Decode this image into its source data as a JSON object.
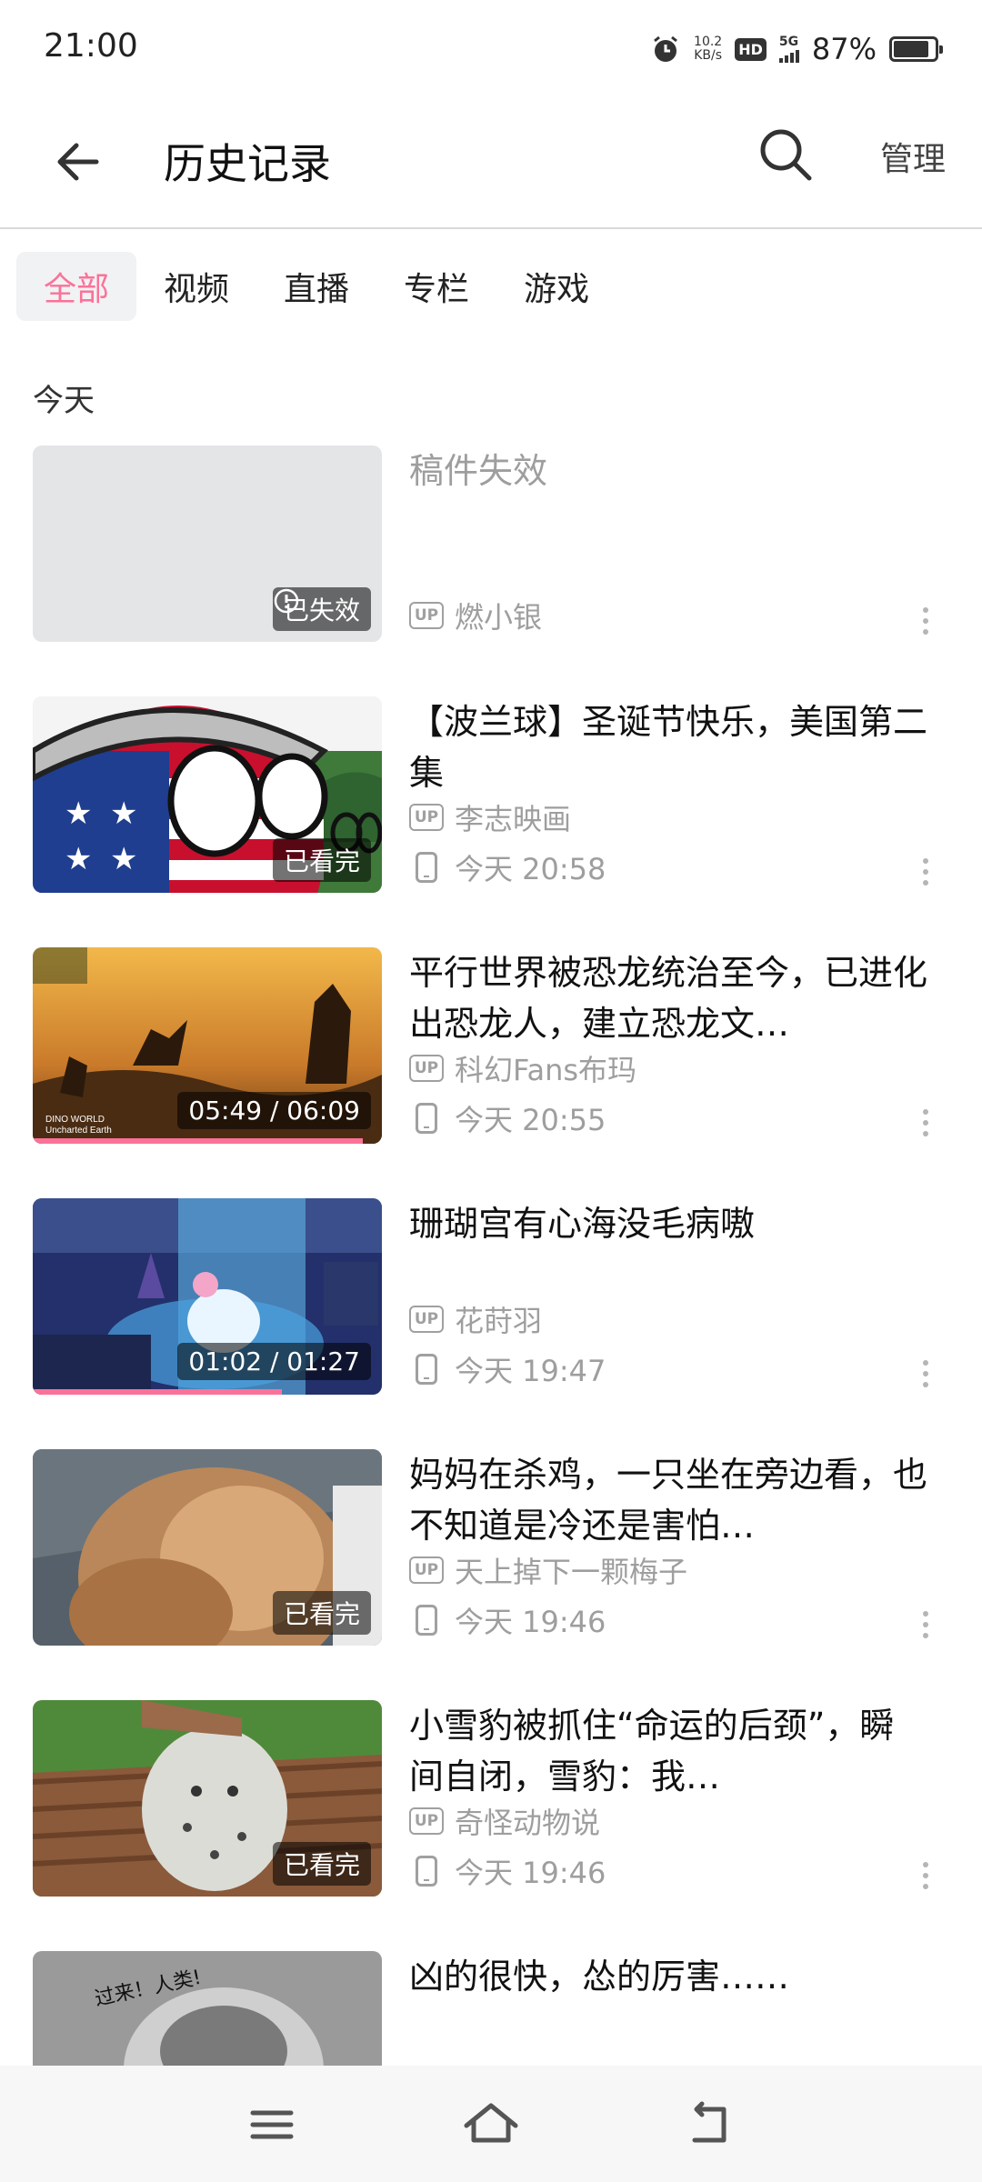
{
  "status_bar": {
    "time": "21:00",
    "net_speed_value": "10.2",
    "net_speed_unit": "KB/s",
    "hd_label": "HD",
    "network": "5G",
    "battery_percent": "87%",
    "battery_level": 0.87
  },
  "header": {
    "title": "历史记录",
    "manage_label": "管理"
  },
  "tabs": [
    {
      "label": "全部",
      "active": true
    },
    {
      "label": "视频",
      "active": false
    },
    {
      "label": "直播",
      "active": false
    },
    {
      "label": "专栏",
      "active": false
    },
    {
      "label": "游戏",
      "active": false
    }
  ],
  "section_title": "今天",
  "items": [
    {
      "title": "稿件失效",
      "up": "燃小银",
      "time": "",
      "badge": "已失效",
      "progress": 0,
      "invalid": true
    },
    {
      "title": "【波兰球】圣诞节快乐，美国第二集",
      "up": "李志映画",
      "time": "今天 20:58",
      "badge": "已看完",
      "progress": 0
    },
    {
      "title": "平行世界被恐龙统治至今，已进化出恐龙人，建立恐龙文…",
      "up": "科幻Fans布玛",
      "time": "今天 20:55",
      "badge": "05:49 / 06:09",
      "progress": 0.945,
      "thumb_text_1": "DINO WORLD",
      "thumb_text_2": "Uncharted Earth"
    },
    {
      "title": "珊瑚宫有心海没毛病嗷",
      "up": "花莳羽",
      "time": "今天 19:47",
      "badge": "01:02 / 01:27",
      "progress": 0.713
    },
    {
      "title": "妈妈在杀鸡，一只坐在旁边看，也不知道是冷还是害怕…",
      "up": "天上掉下一颗梅子",
      "time": "今天 19:46",
      "badge": "已看完",
      "progress": 0
    },
    {
      "title": "小雪豹被抓住“命运的后颈”，瞬间自闭，雪豹：我…",
      "up": "奇怪动物说",
      "time": "今天 19:46",
      "badge": "已看完",
      "progress": 0
    },
    {
      "title": "凶的很快，怂的厉害……",
      "up": "",
      "time": "",
      "badge": "",
      "progress": 0,
      "thumb_text_1": "过来！人类!"
    }
  ],
  "colors": {
    "accent": "#fb7299",
    "secondary_text": "#9e9e9e",
    "tab_bg": "#f1f2f3"
  },
  "icons": {
    "back": "back-arrow-icon",
    "search": "search-icon",
    "up": "up-badge-icon",
    "device": "phone-icon",
    "more": "more-vertical-icon",
    "invalid": "exclamation-circle-icon",
    "nav": [
      "menu-icon",
      "home-icon",
      "back-nav-icon"
    ]
  }
}
